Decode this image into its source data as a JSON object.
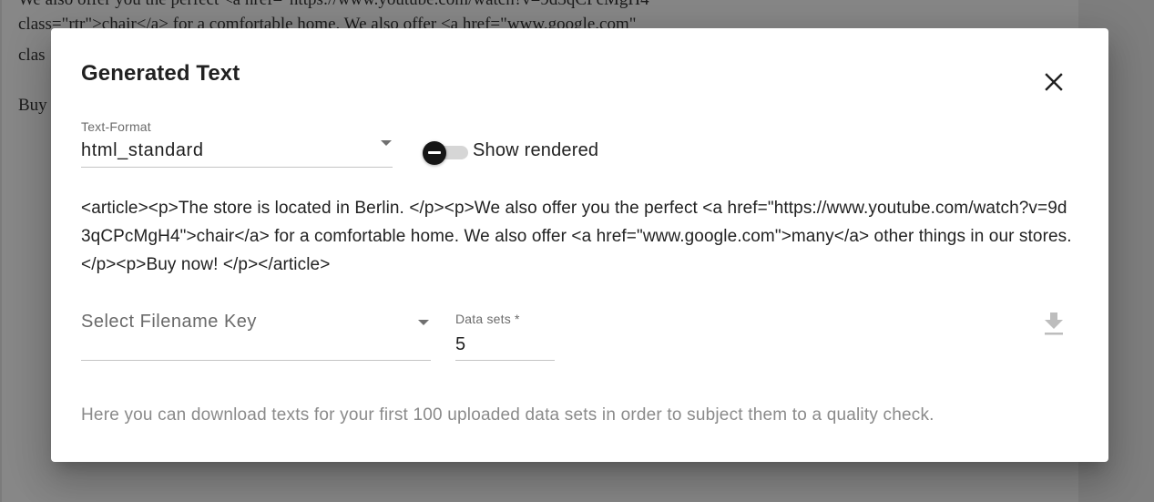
{
  "background": {
    "lines": [
      "We also offer you the perfect <a href=\"https://www.youtube.com/watch?v=9d3qCPcMgH4\"",
      "class=\"rtr\">chair</a> for a comfortable home. We also offer <a href=\"www.google.com\"",
      "clas",
      "Buy"
    ]
  },
  "dialog": {
    "title": "Generated Text",
    "close_icon": "close-icon"
  },
  "text_format": {
    "label": "Text-Format",
    "value": "html_standard"
  },
  "show_rendered": {
    "label": "Show rendered",
    "checked": false
  },
  "generated_text": "<article><p>The store is located in Berlin. </p><p>We also offer you the perfect <a href=\"https://www.youtube.com/watch?v=9d3qCPcMgH4\">chair</a> for a comfortable home. We also offer <a href=\"www.google.com\">many</a> other things in our stores. </p><p>Buy now! </p></article>",
  "filename_key": {
    "placeholder": "Select Filename Key"
  },
  "data_sets": {
    "label": "Data sets *",
    "value": "5"
  },
  "download": {
    "icon": "download-icon"
  },
  "help_text": "Here you can download texts for your first 100 uploaded data sets in order to subject them to a quality check.",
  "colors": {
    "backdrop": "#878787",
    "dialog_bg": "#ffffff",
    "toggle_thumb": "#161616",
    "toggle_track": "#d6d6d6",
    "muted_text": "#8a8a8a"
  }
}
